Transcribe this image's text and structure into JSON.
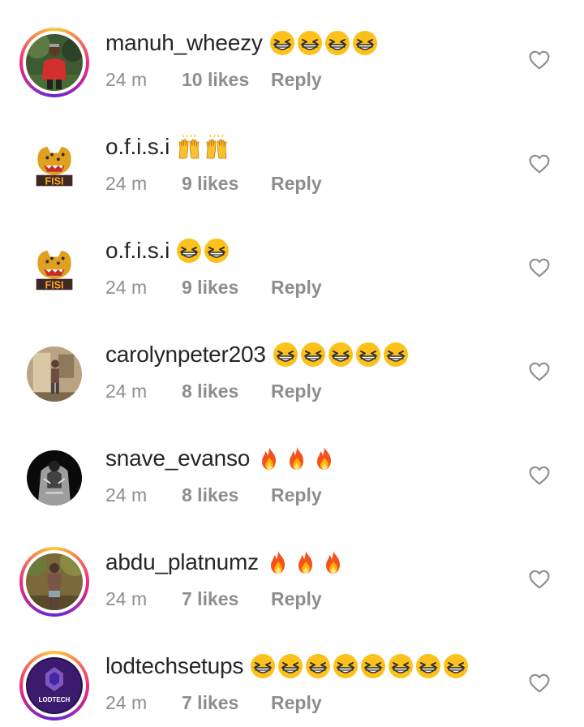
{
  "comments": [
    {
      "username": "manuh_wheezy",
      "emoji": "grinning-squint",
      "emoji_count": 4,
      "time": "24 m",
      "likes": "10 likes",
      "reply": "Reply",
      "avatar": "person-red-shirt",
      "story_ring": true
    },
    {
      "username": "o.f.i.s.i",
      "emoji": "raised-hands",
      "emoji_count": 2,
      "time": "24 m",
      "likes": "9 likes",
      "reply": "Reply",
      "avatar": "hyena-logo-fisi",
      "story_ring": false
    },
    {
      "username": "o.f.i.s.i",
      "emoji": "grinning-squint",
      "emoji_count": 2,
      "time": "24 m",
      "likes": "9 likes",
      "reply": "Reply",
      "avatar": "hyena-logo-fisi",
      "story_ring": false
    },
    {
      "username": "carolynpeter203",
      "emoji": "grinning-squint",
      "emoji_count": 5,
      "time": "24 m",
      "likes": "8 likes",
      "reply": "Reply",
      "avatar": "person-room",
      "story_ring": false
    },
    {
      "username": "snave_evanso",
      "emoji": "fire",
      "emoji_count": 3,
      "time": "24 m",
      "likes": "8 likes",
      "reply": "Reply",
      "avatar": "person-dark-jacket",
      "story_ring": false
    },
    {
      "username": "abdu_platnumz",
      "emoji": "fire",
      "emoji_count": 3,
      "time": "24 m",
      "likes": "7 likes",
      "reply": "Reply",
      "avatar": "person-outdoor",
      "story_ring": true
    },
    {
      "username": "lodtechsetups",
      "emoji": "grinning-squint",
      "emoji_count": 8,
      "time": "24 m",
      "likes": "7 likes",
      "reply": "Reply",
      "avatar": "lodtech-logo",
      "avatar_text": "LODTECH",
      "story_ring": true
    }
  ],
  "colors": {
    "text": "#262626",
    "meta": "#8e8e8e",
    "heart": "#8e8e8e"
  }
}
